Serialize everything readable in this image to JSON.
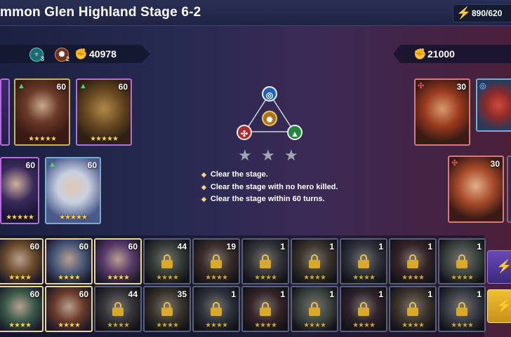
{
  "header": {
    "title": "mmon Glen Highland Stage 6-2",
    "energy": "890/620"
  },
  "left_team": {
    "faction_a_count": "3",
    "faction_b_count": "2",
    "power": "40978"
  },
  "right_team": {
    "power": "21000"
  },
  "left_heroes": [
    {
      "level": "60",
      "class_icon": "forest-icon",
      "stars": "★★★★★"
    },
    {
      "level": "60",
      "class_icon": "forest-icon",
      "stars": "★★★★★"
    },
    {
      "level": "60",
      "class_icon": "forest-icon",
      "stars": "★★★★★"
    },
    {
      "level": "60",
      "class_icon": "forest-icon",
      "stars": "★★★★★"
    },
    {
      "level": "60",
      "class_icon": "forest-icon",
      "stars": "★★★★★"
    }
  ],
  "right_heroes": [
    {
      "level": "30",
      "class_icon": "paw-icon"
    },
    {
      "level": "",
      "class_icon": "water-icon"
    },
    {
      "level": "30",
      "class_icon": "paw-icon"
    }
  ],
  "objectives": [
    "Clear the stage.",
    "Clear the stage with no hero killed.",
    "Clear the stage within 60 turns."
  ],
  "roster_row1": [
    "60",
    "60",
    "60",
    "44",
    "19",
    "1",
    "1",
    "1",
    "1",
    "1",
    ""
  ],
  "roster_row2": [
    "60",
    "60",
    "44",
    "35",
    "1",
    "1",
    "1",
    "1",
    "1",
    "1",
    ""
  ],
  "stage_stars": [
    "★",
    "★",
    "★"
  ],
  "colors": {
    "accent_gold": "#c8b35a",
    "water": "#2f7fd8",
    "fire": "#c93a3a",
    "forest": "#2fa94a",
    "light": "#d6a23a"
  }
}
